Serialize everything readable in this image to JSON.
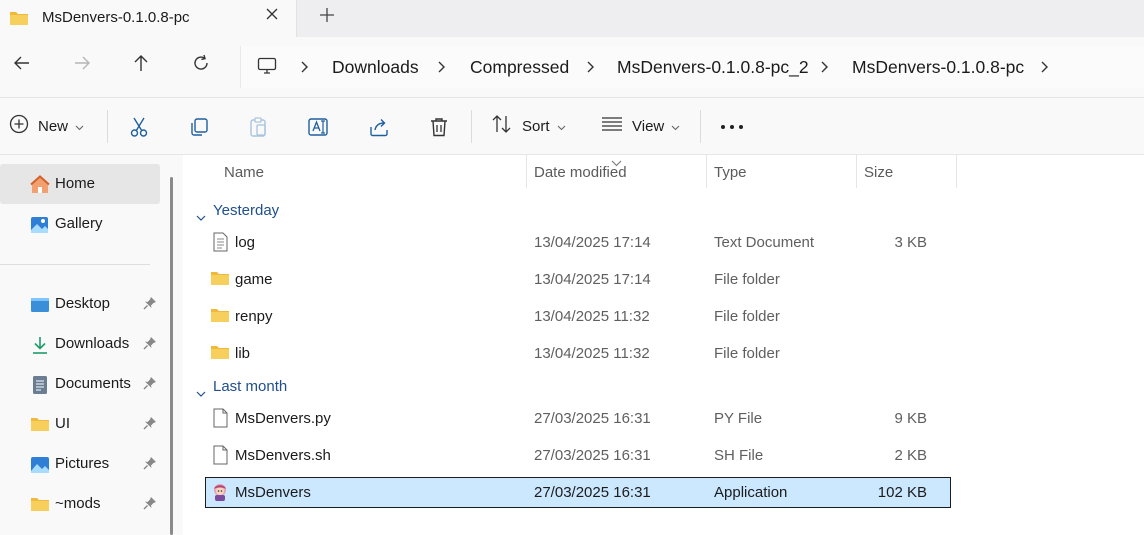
{
  "tab": {
    "title": "MsDenvers-0.1.0.8-pc",
    "close_icon": "close-icon",
    "new_tab_icon": "plus-icon"
  },
  "nav": {
    "back_icon": "arrow-left-icon",
    "forward_icon": "arrow-right-icon",
    "up_icon": "arrow-up-icon",
    "refresh_icon": "refresh-icon"
  },
  "breadcrumb": {
    "root_icon": "this-pc-icon",
    "items": [
      "Downloads",
      "Compressed",
      "MsDenvers-0.1.0.8-pc_2",
      "MsDenvers-0.1.0.8-pc"
    ]
  },
  "toolbar": {
    "new_label": "New",
    "sort_label": "Sort",
    "view_label": "View",
    "icons": [
      "cut-icon",
      "copy-icon",
      "paste-icon",
      "rename-icon",
      "share-icon",
      "delete-icon",
      "more-icon"
    ]
  },
  "sidebar": {
    "items": [
      {
        "label": "Home",
        "icon": "home-icon",
        "selected": true
      },
      {
        "label": "Gallery",
        "icon": "gallery-icon"
      },
      {
        "label": "Desktop",
        "icon": "desktop-icon",
        "pinned": true
      },
      {
        "label": "Downloads",
        "icon": "download-icon",
        "pinned": true
      },
      {
        "label": "Documents",
        "icon": "documents-icon",
        "pinned": true
      },
      {
        "label": "UI",
        "icon": "folder-icon",
        "pinned": true
      },
      {
        "label": "Pictures",
        "icon": "pictures-icon",
        "pinned": true
      },
      {
        "label": "~mods",
        "icon": "folder-icon",
        "pinned": true
      }
    ]
  },
  "columns": {
    "name": "Name",
    "date": "Date modified",
    "type": "Type",
    "size": "Size"
  },
  "groups": [
    {
      "label": "Yesterday",
      "files": [
        {
          "name": "log",
          "date": "13/04/2025 17:14",
          "type": "Text Document",
          "size": "3 KB",
          "icon": "text-file-icon"
        },
        {
          "name": "game",
          "date": "13/04/2025 17:14",
          "type": "File folder",
          "size": "",
          "icon": "folder-icon"
        },
        {
          "name": "renpy",
          "date": "13/04/2025 11:32",
          "type": "File folder",
          "size": "",
          "icon": "folder-icon"
        },
        {
          "name": "lib",
          "date": "13/04/2025 11:32",
          "type": "File folder",
          "size": "",
          "icon": "folder-icon"
        }
      ]
    },
    {
      "label": "Last month",
      "files": [
        {
          "name": "MsDenvers.py",
          "date": "27/03/2025 16:31",
          "type": "PY File",
          "size": "9 KB",
          "icon": "file-icon"
        },
        {
          "name": "MsDenvers.sh",
          "date": "27/03/2025 16:31",
          "type": "SH File",
          "size": "2 KB",
          "icon": "file-icon"
        },
        {
          "name": "MsDenvers",
          "date": "27/03/2025 16:31",
          "type": "Application",
          "size": "102 KB",
          "icon": "app-icon",
          "selected": true
        }
      ]
    }
  ],
  "colors": {
    "accent": "#1f4f8c",
    "selection": "#cce8ff",
    "folder": "#f3c24c"
  }
}
